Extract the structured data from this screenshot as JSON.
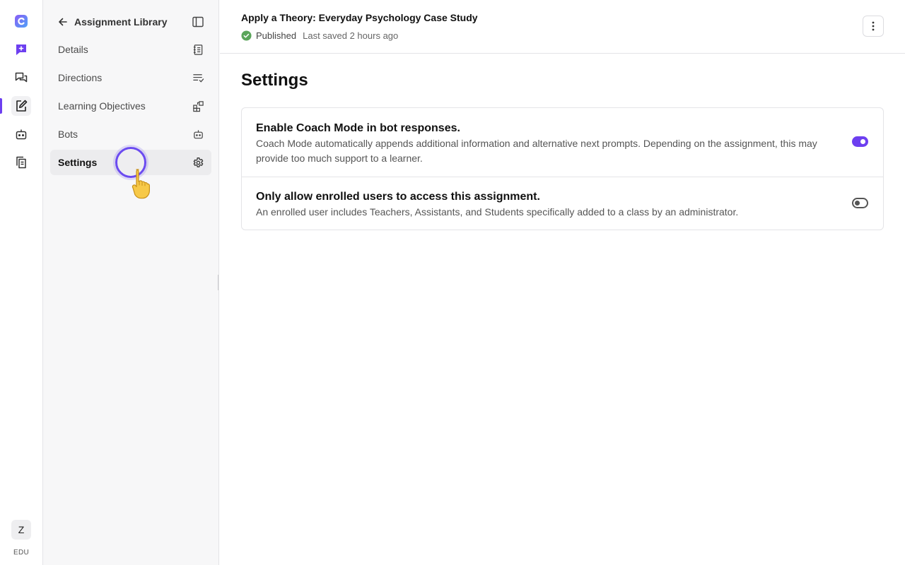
{
  "rail": {
    "items": [
      {
        "name": "logo-icon",
        "active": false
      },
      {
        "name": "new-chat-icon",
        "active": false
      },
      {
        "name": "conversations-icon",
        "active": false
      },
      {
        "name": "assignments-icon",
        "active": true
      },
      {
        "name": "bot-icon",
        "active": false
      },
      {
        "name": "library-icon",
        "active": false
      }
    ],
    "avatar_initial": "Z",
    "org_label": "EDU",
    "accent_color": "#6d3ff0"
  },
  "sidebar": {
    "back_label": "Assignment Library",
    "items": [
      {
        "label": "Details",
        "icon": "notebook-icon",
        "active": false
      },
      {
        "label": "Directions",
        "icon": "list-check-icon",
        "active": false
      },
      {
        "label": "Learning Objectives",
        "icon": "objectives-icon",
        "active": false
      },
      {
        "label": "Bots",
        "icon": "bot-icon",
        "active": false
      },
      {
        "label": "Settings",
        "icon": "gear-icon",
        "active": true
      }
    ]
  },
  "header": {
    "title": "Apply a Theory: Everyday Psychology Case Study",
    "status": "Published",
    "status_color": "#5aa55a",
    "last_saved": "Last saved 2 hours ago"
  },
  "main": {
    "page_title": "Settings",
    "settings": [
      {
        "title": "Enable Coach Mode in bot responses.",
        "description": "Coach Mode automatically appends additional information and alternative next prompts. Depending on the assignment, this may provide too much support to a learner.",
        "enabled": true
      },
      {
        "title": "Only allow enrolled users to access this assignment.",
        "description": "An enrolled user includes Teachers, Assistants, and Students specifically added to a class by an administrator.",
        "enabled": false
      }
    ]
  }
}
